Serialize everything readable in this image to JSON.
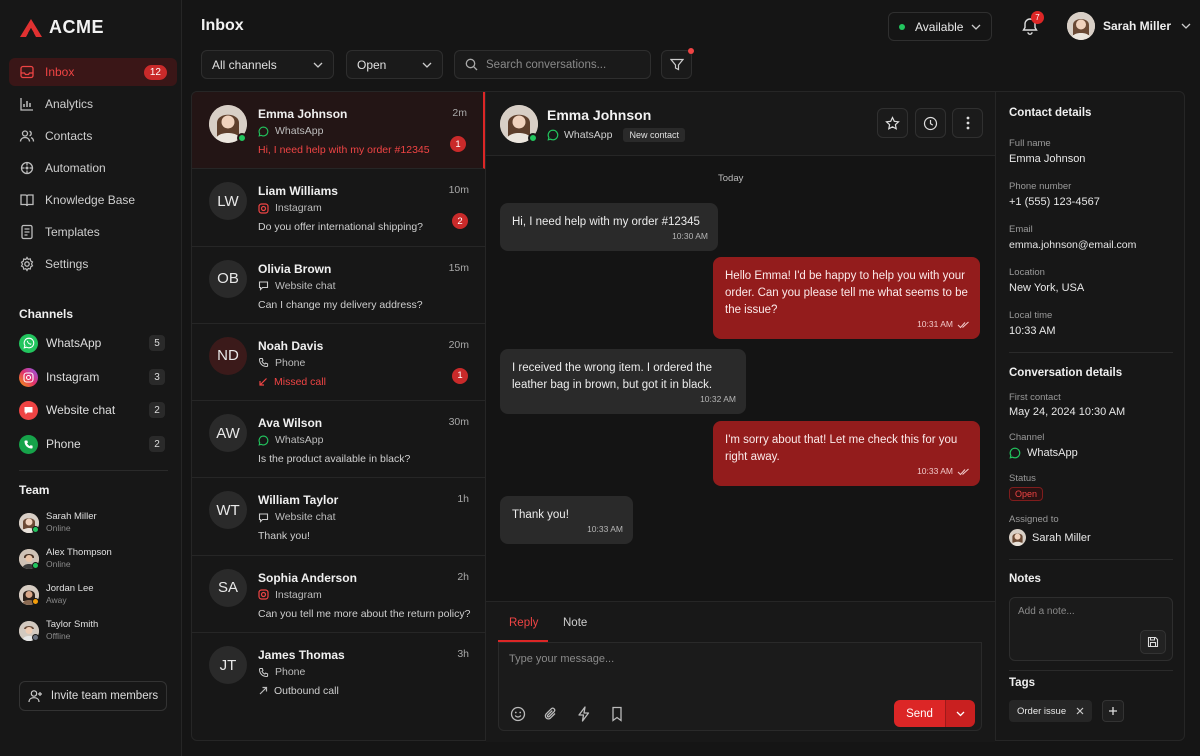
{
  "brand": {
    "name": "ACME",
    "accent": "#dc2626"
  },
  "sidebar": {
    "items": [
      {
        "label": "Inbox",
        "badge": "12",
        "icon": "inbox-icon"
      },
      {
        "label": "Analytics",
        "icon": "bar-chart-icon"
      },
      {
        "label": "Contacts",
        "icon": "users-icon"
      },
      {
        "label": "Automation",
        "icon": "automation-icon"
      },
      {
        "label": "Knowledge Base",
        "icon": "book-icon"
      },
      {
        "label": "Templates",
        "icon": "document-icon"
      },
      {
        "label": "Settings",
        "icon": "gear-icon"
      }
    ],
    "channels_title": "Channels",
    "channels": [
      {
        "label": "WhatsApp",
        "count": "5",
        "color": "#22c55e"
      },
      {
        "label": "Instagram",
        "count": "3",
        "color": "#e1306c"
      },
      {
        "label": "Website chat",
        "count": "2",
        "color": "#ef4444"
      },
      {
        "label": "Phone",
        "count": "2",
        "color": "#16a34a"
      }
    ],
    "team_title": "Team",
    "team": [
      {
        "name": "Sarah Miller",
        "status": "Online",
        "status_color": "#22c55e"
      },
      {
        "name": "Alex Thompson",
        "status": "Online",
        "status_color": "#22c55e"
      },
      {
        "name": "Jordan Lee",
        "status": "Away",
        "status_color": "#f59e0b"
      },
      {
        "name": "Taylor Smith",
        "status": "Offline",
        "status_color": "#6b7280"
      }
    ],
    "invite_label": "Invite team members"
  },
  "header": {
    "title": "Inbox",
    "availability": "Available",
    "notifications": "7",
    "user_name": "Sarah Miller"
  },
  "filters": {
    "channel": "All channels",
    "status": "Open",
    "search_placeholder": "Search conversations..."
  },
  "conversations": [
    {
      "name": "Emma Johnson",
      "time": "2m",
      "channel": "WhatsApp",
      "message": "Hi, I need help with my order #12345",
      "unread": "1"
    },
    {
      "initials": "LW",
      "name": "Liam Williams",
      "time": "10m",
      "channel": "Instagram",
      "message": "Do you offer international shipping?",
      "unread": "2"
    },
    {
      "initials": "OB",
      "name": "Olivia Brown",
      "time": "15m",
      "channel": "Website chat",
      "message": "Can I change my delivery address?"
    },
    {
      "initials": "ND",
      "name": "Noah Davis",
      "time": "20m",
      "channel": "Phone",
      "message": "Missed call",
      "unread": "1"
    },
    {
      "initials": "AW",
      "name": "Ava Wilson",
      "time": "30m",
      "channel": "WhatsApp",
      "message": "Is the product available in black?"
    },
    {
      "initials": "WT",
      "name": "William Taylor",
      "time": "1h",
      "channel": "Website chat",
      "message": "Thank you!"
    },
    {
      "initials": "SA",
      "name": "Sophia Anderson",
      "time": "2h",
      "channel": "Instagram",
      "message": "Can you tell me more about the return policy?"
    },
    {
      "initials": "JT",
      "name": "James Thomas",
      "time": "3h",
      "channel": "Phone",
      "message": "Outbound call"
    }
  ],
  "chat": {
    "name": "Emma Johnson",
    "channel": "WhatsApp",
    "tag": "New contact",
    "day_label": "Today",
    "messages": [
      {
        "dir": "in",
        "text": "Hi, I need help with my order #12345",
        "time": "10:30 AM"
      },
      {
        "dir": "out",
        "text": "Hello Emma! I'd be happy to help you with your order. Can you please tell me what seems to be the issue?",
        "time": "10:31 AM"
      },
      {
        "dir": "in",
        "text": "I received the wrong item. I ordered the leather bag in brown, but got it in black.",
        "time": "10:32 AM"
      },
      {
        "dir": "out",
        "text": "I'm sorry about that! Let me check this for you right away.",
        "time": "10:33 AM"
      },
      {
        "dir": "in",
        "text": "Thank you!",
        "time": "10:33 AM"
      }
    ],
    "tabs": {
      "reply": "Reply",
      "note": "Note"
    },
    "input_placeholder": "Type your message...",
    "send_label": "Send"
  },
  "details": {
    "contact_title": "Contact details",
    "full_name_label": "Full name",
    "full_name": "Emma Johnson",
    "phone_label": "Phone number",
    "phone": "+1 (555) 123-4567",
    "email_label": "Email",
    "email": "emma.johnson@email.com",
    "location_label": "Location",
    "location": "New York, USA",
    "local_time_label": "Local time",
    "local_time": "10:33 AM",
    "conv_title": "Conversation details",
    "first_contact_label": "First contact",
    "first_contact": "May 24, 2024 10:30 AM",
    "channel_label": "Channel",
    "channel": "WhatsApp",
    "status_label": "Status",
    "status": "Open",
    "assigned_label": "Assigned to",
    "assigned": "Sarah Miller",
    "notes_title": "Notes",
    "notes_placeholder": "Add a note...",
    "tags_title": "Tags",
    "tag": "Order issue"
  }
}
